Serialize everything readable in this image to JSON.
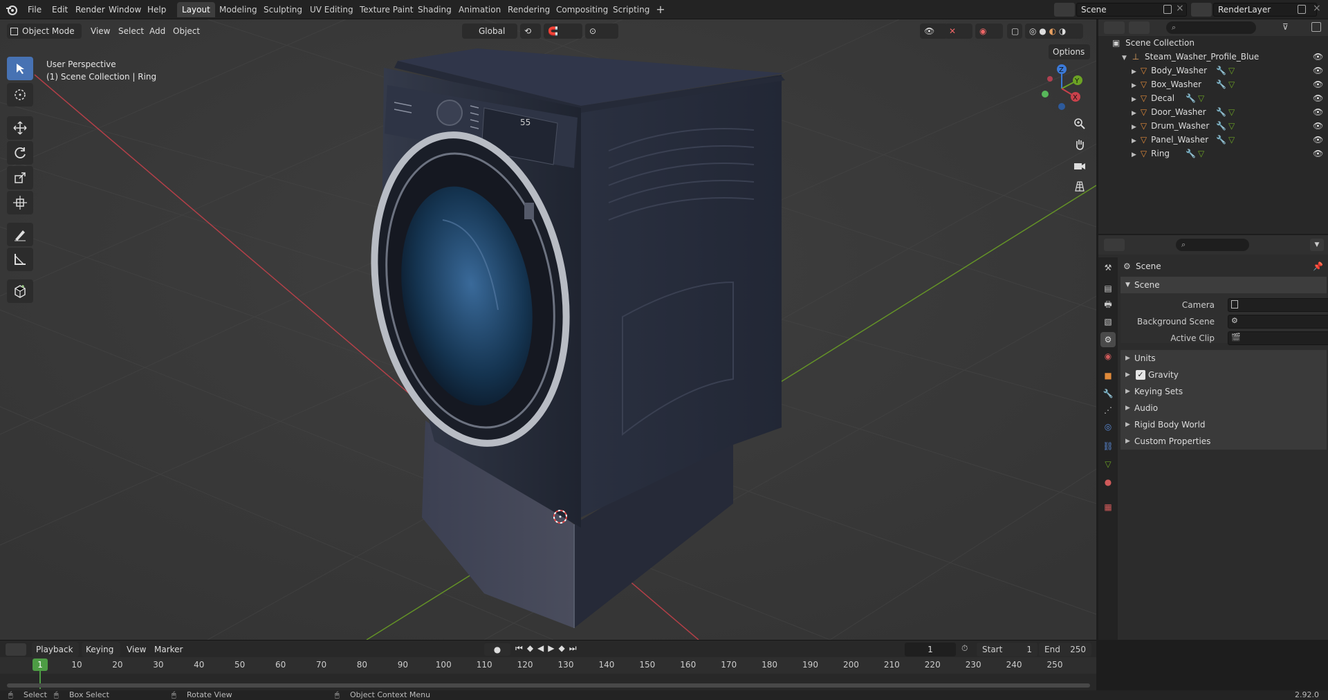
{
  "topbar": {
    "menus": [
      "File",
      "Edit",
      "Render",
      "Window",
      "Help"
    ],
    "workspaces": [
      "Layout",
      "Modeling",
      "Sculpting",
      "UV Editing",
      "Texture Paint",
      "Shading",
      "Animation",
      "Rendering",
      "Compositing",
      "Scripting"
    ],
    "active_workspace": "Layout",
    "scene_name": "Scene",
    "view_layer": "RenderLayer"
  },
  "viewport_header": {
    "mode": "Object Mode",
    "menus": [
      "View",
      "Select",
      "Add",
      "Object"
    ],
    "transform_orientation": "Global",
    "options_label": "Options"
  },
  "viewport": {
    "perspective_label": "User Perspective",
    "context_label": "(1) Scene Collection | Ring",
    "display_panel_value": "55",
    "gizmo_axes": [
      "X",
      "Y",
      "Z"
    ],
    "colors": {
      "x_axis": "#c9414b",
      "y_axis": "#6ca324",
      "z_axis": "#3b7ad9",
      "body": "#272c3b",
      "active_tool": "#4772b3"
    }
  },
  "toolbar": {
    "tools": [
      "select-box",
      "cursor",
      "move",
      "rotate",
      "scale",
      "transform",
      "annotate",
      "measure",
      "add-cube"
    ]
  },
  "outliner": {
    "root": "Scene Collection",
    "collection": "Steam_Washer_Profile_Blue",
    "objects": [
      "Body_Washer",
      "Box_Washer",
      "Decal",
      "Door_Washer",
      "Drum_Washer",
      "Panel_Washer",
      "Ring"
    ]
  },
  "properties": {
    "context": "Scene",
    "panel_title": "Scene",
    "fields": [
      {
        "label": "Camera",
        "value": ""
      },
      {
        "label": "Background Scene",
        "value": ""
      },
      {
        "label": "Active Clip",
        "value": ""
      }
    ],
    "sections": [
      "Units",
      "Gravity",
      "Keying Sets",
      "Audio",
      "Rigid Body World",
      "Custom Properties"
    ],
    "gravity_enabled": true
  },
  "timeline": {
    "menus": [
      "Playback",
      "Keying",
      "View",
      "Marker"
    ],
    "current_frame": "1",
    "start_label": "Start",
    "start": "1",
    "end_label": "End",
    "end": "250",
    "ruler": [
      "1",
      "10",
      "20",
      "30",
      "40",
      "50",
      "60",
      "70",
      "80",
      "90",
      "100",
      "110",
      "120",
      "130",
      "140",
      "150",
      "160",
      "170",
      "180",
      "190",
      "200",
      "210",
      "220",
      "230",
      "240",
      "250"
    ]
  },
  "statusbar": {
    "items": [
      "Select",
      "Box Select",
      "Rotate View",
      "Object Context Menu"
    ],
    "version": "2.92.0"
  }
}
